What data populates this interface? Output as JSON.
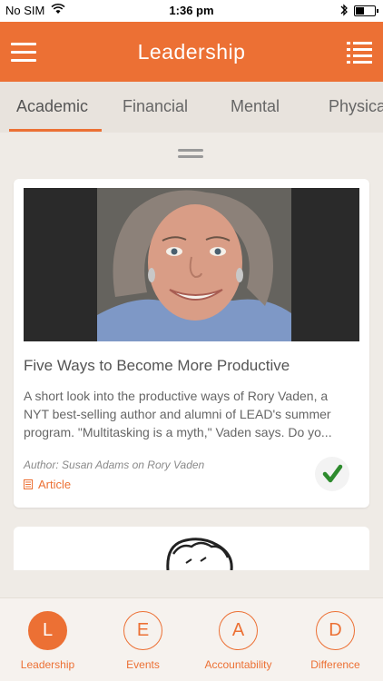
{
  "status_bar": {
    "carrier": "No SIM",
    "time": "1:36 pm"
  },
  "nav": {
    "title": "Leadership"
  },
  "tabs": [
    {
      "label": "Academic",
      "active": true
    },
    {
      "label": "Financial",
      "active": false
    },
    {
      "label": "Mental",
      "active": false
    },
    {
      "label": "Physical",
      "active": false
    }
  ],
  "card": {
    "title": "Five Ways to Become More Productive",
    "summary_lines": [
      "A short look into the productive ways of Rory Vaden, a",
      "NYT best-selling author and alumni of LEAD's summer",
      "program. \"Multitasking is a myth,\" Vaden says. Do yo..."
    ],
    "author": "Author: Susan Adams on Rory Vaden",
    "type": "Article",
    "completed": true
  },
  "bottom_nav": [
    {
      "letter": "L",
      "label": "Leadership",
      "active": true
    },
    {
      "letter": "E",
      "label": "Events",
      "active": false
    },
    {
      "letter": "A",
      "label": "Accountability",
      "active": false
    },
    {
      "letter": "D",
      "label": "Difference",
      "active": false
    }
  ],
  "colors": {
    "accent": "#ec7034",
    "check": "#2e8b2e",
    "background": "#efebe6"
  },
  "icons": [
    "menu-icon",
    "list-icon",
    "document-icon",
    "checkmark-icon",
    "wifi-icon",
    "bluetooth-icon",
    "battery-icon"
  ]
}
